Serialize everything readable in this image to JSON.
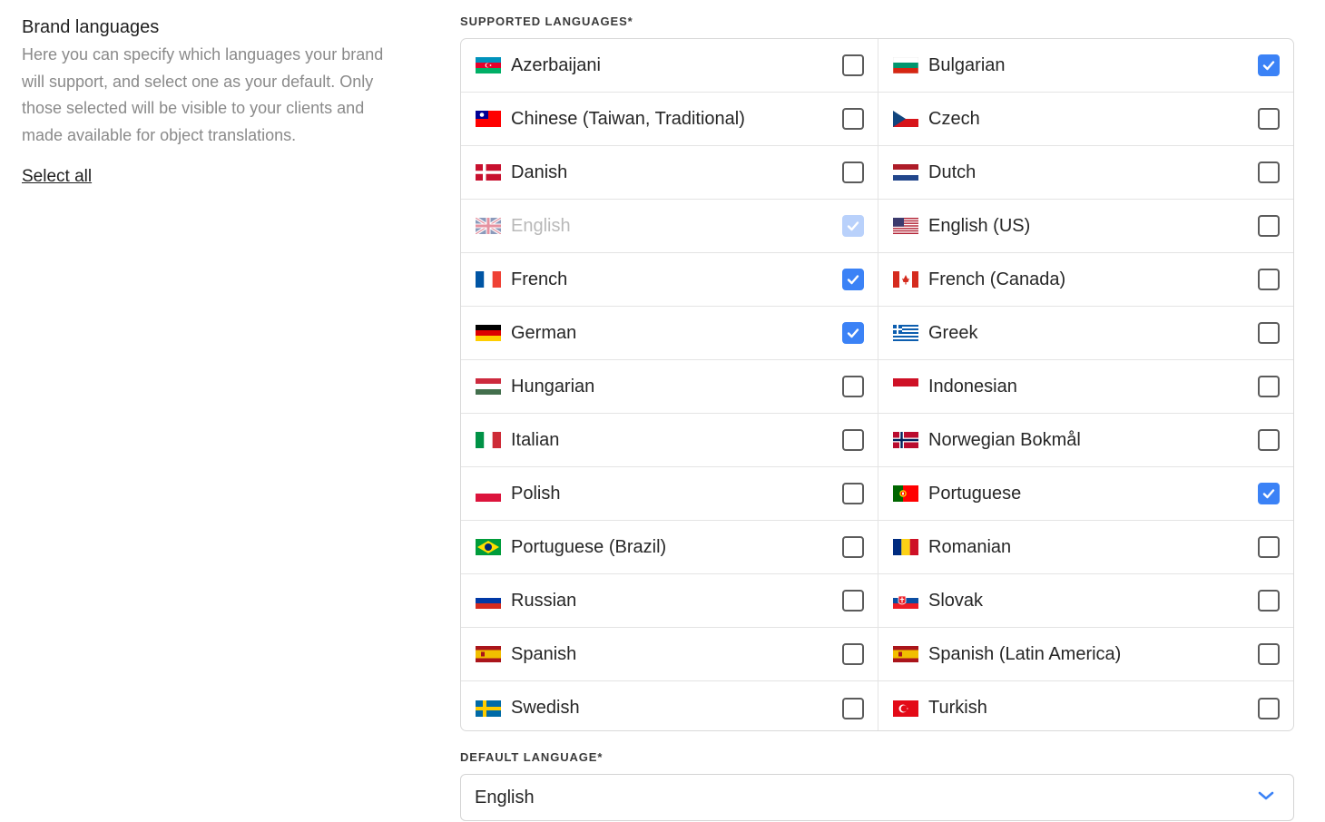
{
  "sidebar": {
    "title": "Brand languages",
    "description": "Here you can specify which languages your brand will support, and select one as your default. Only those selected will be visible to your clients and made available for object translations.",
    "select_all": "Select all"
  },
  "supported_label": "SUPPORTED LANGUAGES*",
  "default_label": "DEFAULT LANGUAGE*",
  "default_value": "English",
  "accent_color": "#3b82f6",
  "languages": [
    {
      "label": "Azerbaijani",
      "flag": "az",
      "checked": false,
      "disabled": false
    },
    {
      "label": "Bulgarian",
      "flag": "bg",
      "checked": true,
      "disabled": false
    },
    {
      "label": "Chinese (Taiwan, Traditional)",
      "flag": "tw",
      "checked": false,
      "disabled": false
    },
    {
      "label": "Czech",
      "flag": "cz",
      "checked": false,
      "disabled": false
    },
    {
      "label": "Danish",
      "flag": "dk",
      "checked": false,
      "disabled": false
    },
    {
      "label": "Dutch",
      "flag": "nl",
      "checked": false,
      "disabled": false
    },
    {
      "label": "English",
      "flag": "gb",
      "checked": true,
      "disabled": true
    },
    {
      "label": "English (US)",
      "flag": "us",
      "checked": false,
      "disabled": false
    },
    {
      "label": "French",
      "flag": "fr",
      "checked": true,
      "disabled": false
    },
    {
      "label": "French (Canada)",
      "flag": "ca",
      "checked": false,
      "disabled": false
    },
    {
      "label": "German",
      "flag": "de",
      "checked": true,
      "disabled": false
    },
    {
      "label": "Greek",
      "flag": "gr",
      "checked": false,
      "disabled": false
    },
    {
      "label": "Hungarian",
      "flag": "hu",
      "checked": false,
      "disabled": false
    },
    {
      "label": "Indonesian",
      "flag": "id",
      "checked": false,
      "disabled": false
    },
    {
      "label": "Italian",
      "flag": "it",
      "checked": false,
      "disabled": false
    },
    {
      "label": "Norwegian Bokmål",
      "flag": "no",
      "checked": false,
      "disabled": false
    },
    {
      "label": "Polish",
      "flag": "pl",
      "checked": false,
      "disabled": false
    },
    {
      "label": "Portuguese",
      "flag": "pt",
      "checked": true,
      "disabled": false
    },
    {
      "label": "Portuguese (Brazil)",
      "flag": "br",
      "checked": false,
      "disabled": false
    },
    {
      "label": "Romanian",
      "flag": "ro",
      "checked": false,
      "disabled": false
    },
    {
      "label": "Russian",
      "flag": "ru",
      "checked": false,
      "disabled": false
    },
    {
      "label": "Slovak",
      "flag": "sk",
      "checked": false,
      "disabled": false
    },
    {
      "label": "Spanish",
      "flag": "es",
      "checked": false,
      "disabled": false
    },
    {
      "label": "Spanish (Latin America)",
      "flag": "es",
      "checked": false,
      "disabled": false
    },
    {
      "label": "Swedish",
      "flag": "se",
      "checked": false,
      "disabled": false
    },
    {
      "label": "Turkish",
      "flag": "tr",
      "checked": false,
      "disabled": false
    }
  ]
}
